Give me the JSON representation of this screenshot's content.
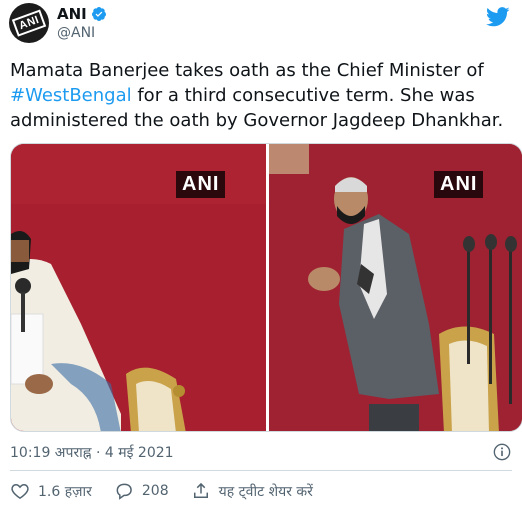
{
  "author": {
    "name": "ANI",
    "handle": "@ANI",
    "avatar_text": "ANI"
  },
  "tweet": {
    "text_before": "Mamata Banerjee takes oath as the Chief Minister of ",
    "hashtag": "#WestBengal",
    "text_after": " for a third consecutive term. She was administered the oath by Governor Jagdeep Dhankhar."
  },
  "media": {
    "watermark_left": "ANI",
    "watermark_right": "ANI",
    "colors": {
      "backdrop": "#a51c2e"
    }
  },
  "meta": {
    "timestamp": "10:19 अपराह्न · 4 मई 2021"
  },
  "actions": {
    "likes": "1.6 हज़ार",
    "replies": "208",
    "share_label": "यह ट्वीट शेयर करें"
  },
  "colors": {
    "accent": "#1d9bf0",
    "text": "#0f1419",
    "muted": "#536471"
  }
}
